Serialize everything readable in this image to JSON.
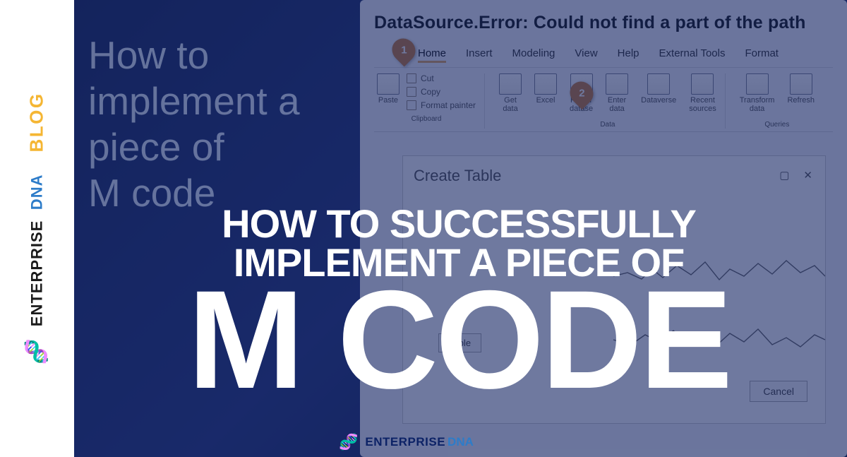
{
  "sidebar": {
    "brand1": "ENTERPRISE",
    "brand2": "DNA",
    "blog": "BLOG"
  },
  "background": {
    "blurb_lines": [
      "How to",
      "implement a",
      "piece of",
      "M code"
    ],
    "error_title": "DataSource.Error: Could not find a part of the path",
    "ribbon_tabs": [
      "Home",
      "Insert",
      "Modeling",
      "View",
      "Help",
      "External Tools",
      "Format"
    ],
    "clipboard": {
      "paste": "Paste",
      "cut": "Cut",
      "copy": "Copy",
      "format_painter": "Format painter",
      "group": "Clipboard"
    },
    "data_group": {
      "items": [
        "Get\ndata",
        "Excel",
        "Power\ndatase",
        "Enter\ndata",
        "Dataverse",
        "Recent\nsources"
      ],
      "group": "Data"
    },
    "queries_group": {
      "items": [
        "Transform\ndata",
        "Refresh"
      ],
      "group": "Queries"
    },
    "marker1": "1",
    "marker2": "2",
    "create_table": "Create Table",
    "table_btn": "Table",
    "cancel_btn": "Cancel"
  },
  "headline": {
    "line1": "HOW TO SUCCESSFULLY",
    "line2": "IMPLEMENT A PIECE OF",
    "big": "M CODE"
  },
  "footer": {
    "text1": "ENTERPRISE",
    "text2": "DNA"
  }
}
